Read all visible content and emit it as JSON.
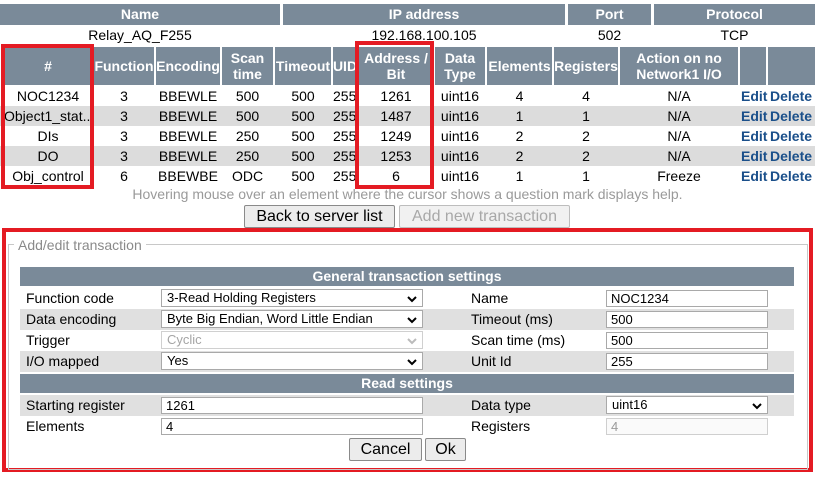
{
  "server": {
    "headers": {
      "name": "Name",
      "ip": "IP address",
      "port": "Port",
      "protocol": "Protocol"
    },
    "name": "Relay_AQ_F255",
    "ip": "192.168.100.105",
    "port": "502",
    "protocol": "TCP"
  },
  "table": {
    "headers": {
      "num": "#",
      "function": "Function",
      "encoding": "Encoding",
      "scan_time": "Scan time",
      "timeout": "Timeout",
      "uid": "UID",
      "address": "Address / Bit",
      "data_type": "Data Type",
      "elements": "Elements",
      "registers": "Registers",
      "action": "Action on no Network1 I/O"
    },
    "rows": [
      {
        "name": "NOC1234",
        "function": "3",
        "encoding": "BBEWLE",
        "scan_time": "500",
        "timeout": "500",
        "uid": "255",
        "address": "1261",
        "data_type": "uint16",
        "elements": "4",
        "registers": "4",
        "action": "N/A",
        "edit": "Edit",
        "delete": "Delete"
      },
      {
        "name": "Object1_stat...",
        "function": "3",
        "encoding": "BBEWLE",
        "scan_time": "500",
        "timeout": "500",
        "uid": "255",
        "address": "1487",
        "data_type": "uint16",
        "elements": "1",
        "registers": "1",
        "action": "N/A",
        "edit": "Edit",
        "delete": "Delete"
      },
      {
        "name": "DIs",
        "function": "3",
        "encoding": "BBEWLE",
        "scan_time": "250",
        "timeout": "500",
        "uid": "255",
        "address": "1249",
        "data_type": "uint16",
        "elements": "2",
        "registers": "2",
        "action": "N/A",
        "edit": "Edit",
        "delete": "Delete"
      },
      {
        "name": "DO",
        "function": "3",
        "encoding": "BBEWLE",
        "scan_time": "250",
        "timeout": "500",
        "uid": "255",
        "address": "1253",
        "data_type": "uint16",
        "elements": "2",
        "registers": "2",
        "action": "N/A",
        "edit": "Edit",
        "delete": "Delete"
      },
      {
        "name": "Obj_control",
        "function": "6",
        "encoding": "BBEWBE",
        "scan_time": "ODC",
        "timeout": "500",
        "uid": "255",
        "address": "6",
        "data_type": "uint16",
        "elements": "1",
        "registers": "1",
        "action": "Freeze",
        "edit": "Edit",
        "delete": "Delete"
      }
    ]
  },
  "hint": "Hovering mouse over an element where the cursor shows a question mark displays help.",
  "buttons": {
    "back": "Back to server list",
    "add_new": "Add new transaction",
    "cancel": "Cancel",
    "ok": "Ok"
  },
  "form": {
    "legend": "Add/edit transaction",
    "general_header": "General transaction settings",
    "read_header": "Read settings",
    "function_code": {
      "label": "Function code",
      "value": "3-Read Holding Registers"
    },
    "data_encoding": {
      "label": "Data encoding",
      "value": "Byte Big Endian, Word Little Endian"
    },
    "trigger": {
      "label": "Trigger",
      "value": "Cyclic"
    },
    "io_mapped": {
      "label": "I/O mapped",
      "value": "Yes"
    },
    "name": {
      "label": "Name",
      "value": "NOC1234"
    },
    "timeout": {
      "label": "Timeout (ms)",
      "value": "500"
    },
    "scan_time": {
      "label": "Scan time (ms)",
      "value": "500"
    },
    "unit_id": {
      "label": "Unit Id",
      "value": "255"
    },
    "starting_register": {
      "label": "Starting register",
      "value": "1261"
    },
    "elements": {
      "label": "Elements",
      "value": "4"
    },
    "data_type": {
      "label": "Data type",
      "value": "uint16"
    },
    "registers": {
      "label": "Registers",
      "value": "4"
    }
  },
  "colors": {
    "header_bg": "#7a8a99",
    "highlight": "#e41b23",
    "link": "#1a4f8a"
  }
}
